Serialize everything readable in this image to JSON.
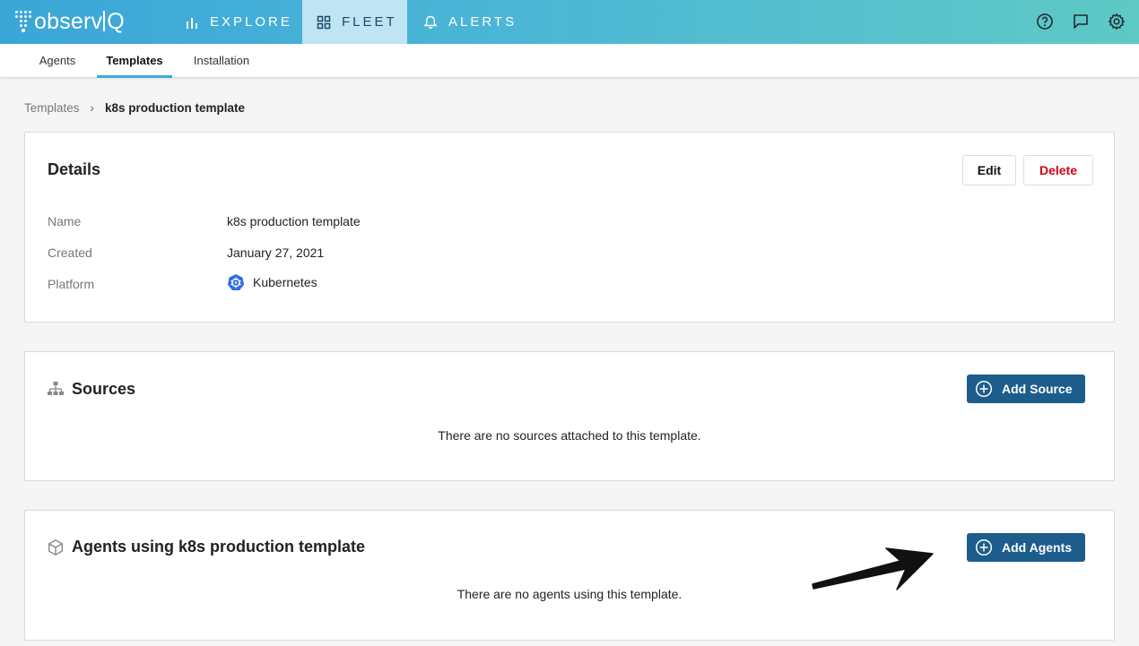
{
  "app": {
    "logo_text_left": "observ",
    "logo_text_right": "Q"
  },
  "nav": {
    "explore": "EXPLORE",
    "fleet": "FLEET",
    "alerts": "ALERTS"
  },
  "top_icons": [
    "help-icon",
    "feedback-icon",
    "settings-icon"
  ],
  "subnav": {
    "tabs": [
      {
        "label": "Agents"
      },
      {
        "label": "Templates",
        "active": true
      },
      {
        "label": "Installation"
      }
    ]
  },
  "breadcrumb": {
    "parent": "Templates",
    "separator": "›",
    "current": "k8s production template"
  },
  "details": {
    "title": "Details",
    "edit_label": "Edit",
    "delete_label": "Delete",
    "fields": [
      {
        "label": "Name",
        "value": "k8s production template"
      },
      {
        "label": "Created",
        "value": "January 27, 2021"
      },
      {
        "label": "Platform",
        "value": "Kubernetes",
        "icon": "kubernetes-icon"
      }
    ]
  },
  "sources": {
    "title": "Sources",
    "add_label": "Add Source",
    "empty_text": "There are no sources attached to this template."
  },
  "agents": {
    "title": "Agents using k8s production template",
    "add_label": "Add Agents",
    "empty_text": "There are no agents using this template."
  },
  "colors": {
    "primary": "#1d5d8c",
    "danger": "#d0021b",
    "accent": "#3ea9d9",
    "kubernetes": "#326ce5"
  }
}
